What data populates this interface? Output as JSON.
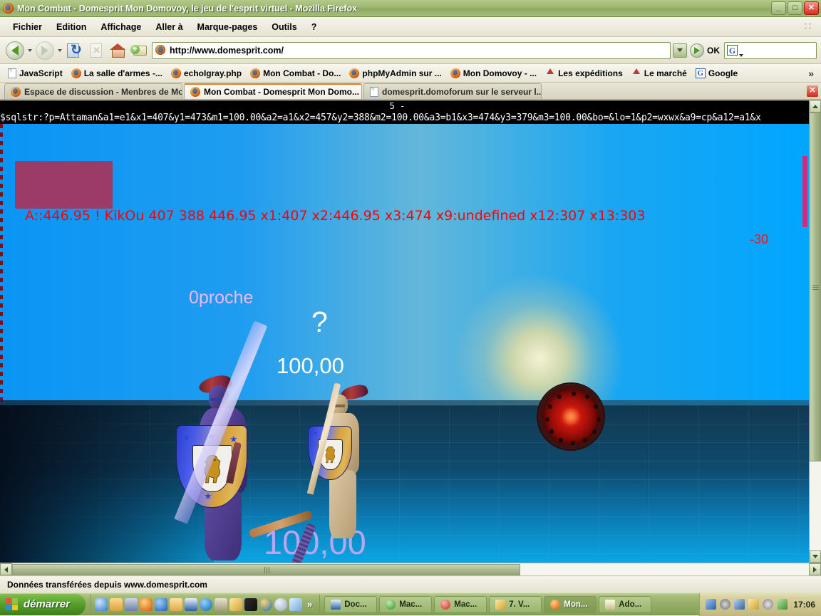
{
  "window": {
    "title": "Mon Combat - Domesprit Mon Domovoy, le jeu de l'esprit virtuel - Mozilla Firefox",
    "app_icon": "firefox-icon",
    "minimize_label": "_",
    "maximize_label": "□",
    "close_label": "✕"
  },
  "menubar": {
    "items": [
      {
        "label": "Fichier",
        "name": "menu-fichier"
      },
      {
        "label": "Edition",
        "name": "menu-edition"
      },
      {
        "label": "Affichage",
        "name": "menu-affichage"
      },
      {
        "label": "Aller à",
        "name": "menu-aller-a"
      },
      {
        "label": "Marque-pages",
        "name": "menu-marque-pages"
      },
      {
        "label": "Outils",
        "name": "menu-outils"
      },
      {
        "label": "?",
        "name": "menu-aide"
      }
    ]
  },
  "toolbar": {
    "back": "Précédente",
    "forward": "Suivante",
    "reload": "Actualiser",
    "stop": "Arrêter",
    "home": "Accueil",
    "add": "Ajouter",
    "url_value": "http://www.domesprit.com/",
    "url_favicon": "firefox-favicon",
    "go_label": "OK",
    "search_engine": "G",
    "search_value": ""
  },
  "bookmarks": {
    "items": [
      {
        "label": "JavaScript",
        "icon": "doc-icon"
      },
      {
        "label": "La salle d'armes -...",
        "icon": "firefox-icon"
      },
      {
        "label": "echoIgray.php",
        "icon": "firefox-icon"
      },
      {
        "label": "Mon Combat - Do...",
        "icon": "firefox-icon"
      },
      {
        "label": "phpMyAdmin sur ...",
        "icon": "firefox-icon"
      },
      {
        "label": "Mon Domovoy - ...",
        "icon": "firefox-icon"
      },
      {
        "label": "Les expéditions",
        "icon": "gnome-icon"
      },
      {
        "label": "Le marché",
        "icon": "gnome-icon"
      },
      {
        "label": "Google",
        "icon": "google-icon"
      }
    ],
    "overflow_label": "»"
  },
  "tabs": {
    "items": [
      {
        "label": "Espace de discussion - Menbres de Mo...",
        "icon": "firefox-icon",
        "active": false
      },
      {
        "label": "Mon Combat - Domesprit Mon Domo...",
        "icon": "firefox-icon",
        "active": true
      },
      {
        "label": "domesprit.domoforum sur le serveur l...",
        "icon": "doc-icon",
        "active": false
      }
    ],
    "close_label": "✕"
  },
  "page": {
    "debug_top": "5 -",
    "debug_sql": "$sqlstr:?p=Attaman&a1=e1&x1=407&y1=473&m1=100.00&a2=a1&x2=457&y2=388&m2=100.00&a3=b1&x3=474&y3=379&m3=100.00&bo=&lo=1&p2=wxwx&a9=cp&a12=a1&x",
    "red_status": "A::446.95 !  KikOu   407 388  446.95 x1:407 x2:446.95 x3:474 x9:undefined x12:307 x13:303",
    "damage_label": "-30",
    "proche_label": "0proche",
    "question_label": "?",
    "hp_enemy": "100,00",
    "hp_player": "100,00",
    "colors": {
      "red_text": "#ff0000",
      "maroon_box": "#9c3a68",
      "pink_strip": "#d6297a",
      "proche_text": "#efb7ef",
      "hp_player_text": "#b9a6f0",
      "hp_enemy_text": "#ffffff"
    },
    "sprites": {
      "player_knight": "knight-purple",
      "enemy_knight": "knight-tan",
      "player_shield": "heraldic-shield-lion",
      "enemy_shield": "heraldic-shield-lion",
      "ground_object": "red-round-buckler",
      "sun": "sun-glow"
    }
  },
  "statusbar": {
    "text": "Données transférées depuis www.domesprit.com"
  },
  "taskbar": {
    "start_label": "démarrer",
    "quick_launch": [
      "ie-icon",
      "folder-icon",
      "media-icon",
      "firefox-icon",
      "thunderbird-icon",
      "explorer-icon",
      "word-icon",
      "bs-icon",
      "printer-icon",
      "macromedia-icon",
      "winamp-icon",
      "realplayer-icon",
      "opera-icon",
      "paint-icon"
    ],
    "quick_launch_more": "»",
    "tasks": [
      {
        "label": "Doc...",
        "icon": "word-icon",
        "active": false
      },
      {
        "label": "Mac...",
        "icon": "macromedia-green-icon",
        "active": false
      },
      {
        "label": "Mac...",
        "icon": "macromedia-red-icon",
        "active": false
      },
      {
        "label": "7. V...",
        "icon": "macromedia-flash-icon",
        "active": false
      },
      {
        "label": "Mon...",
        "icon": "firefox-icon",
        "active": true
      },
      {
        "label": "Ado...",
        "icon": "notepad-icon",
        "active": false
      }
    ],
    "tray": [
      "network-icon",
      "volume-icon",
      "display-icon",
      "shield-icon",
      "cd-icon",
      "update-icon"
    ],
    "clock": "17:06"
  }
}
